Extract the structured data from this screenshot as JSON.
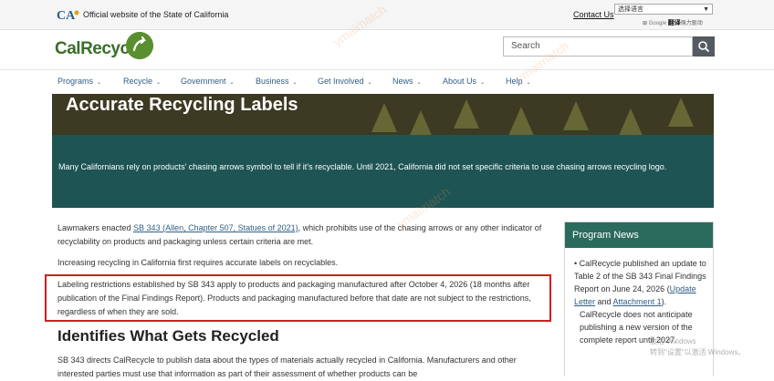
{
  "topbar": {
    "official_text": "Official website of the State of California",
    "contact_label": "Contact Us",
    "language_select": "选择语言",
    "google_label": "Google",
    "translate_label": "翻译",
    "powered_label": "强力驱动"
  },
  "header": {
    "brand": "CalRecycle",
    "search_placeholder": "Search"
  },
  "nav": {
    "items": [
      {
        "label": "Programs"
      },
      {
        "label": "Recycle"
      },
      {
        "label": "Government"
      },
      {
        "label": "Business"
      },
      {
        "label": "Get Involved"
      },
      {
        "label": "News"
      },
      {
        "label": "About Us"
      },
      {
        "label": "Help"
      }
    ]
  },
  "hero": {
    "title": "Accurate Recycling Labels",
    "description": "Many Californians rely on products’ chasing arrows symbol to tell if it’s recyclable. Until 2021, California did not set specific criteria to use chasing arrows recycling logo."
  },
  "content": {
    "p1_before": "Lawmakers enacted ",
    "p1_link": "SB 343 (Allen, Chapter 507, Statues of 2021)",
    "p1_after": ", which prohibits use of the chasing arrows or any other indicator of recyclability on products and packaging unless certain criteria are met.",
    "p2": "Increasing recycling in California first requires accurate labels on recyclables.",
    "p3": "Labeling restrictions established by SB 343 apply to products and packaging manufactured after October 4, 2026 (18 months after publication of the Final Findings Report). Products and packaging manufactured before that date are not subject to the restrictions, regardless of when they are sold.",
    "section_heading": "Identifies What Gets Recycled",
    "p4": "SB 343 directs CalRecycle to publish data about the types of materials actually recycled in California. Manufacturers and other interested parties must use that information as part of their assessment of whether products can be"
  },
  "program_news": {
    "heading": "Program News",
    "item1_text": "CalRecycle published an update to Table 2 of the SB 343 Final Findings Report on June 24, 2026 (",
    "item1_link1": "Update Letter",
    "item1_and": " and ",
    "item1_link2": "Attachment 1",
    "item1_end": ").",
    "item2": "CalRecycle does not anticipate publishing a new version of the complete report until 2027."
  },
  "overlay": {
    "windows_line1": "激活 Windows",
    "windows_line2": "转到\"设置\"以激活 Windows。",
    "watermark": "ymaimatch"
  },
  "colors": {
    "hero_band": "#1f5454",
    "news_header": "#2b6b5e",
    "link": "#2f5d86",
    "highlight_border": "#d21f1f",
    "brand_green": "#3a6e2a"
  }
}
